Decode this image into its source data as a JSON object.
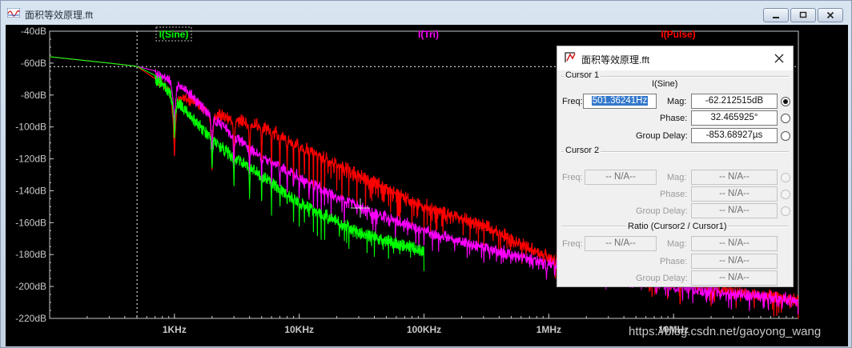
{
  "window": {
    "title": "面积等效原理.fft",
    "controls": [
      "minimize-icon",
      "restore-icon",
      "close-icon"
    ]
  },
  "plot": {
    "traces": [
      {
        "name": "I(Sine)",
        "color": "#00ff00"
      },
      {
        "name": "I(Tri)",
        "color": "#ff00ff"
      },
      {
        "name": "I(Pulse)",
        "color": "#ff0000"
      }
    ],
    "y_ticks": [
      "-40dB",
      "-60dB",
      "-80dB",
      "-100dB",
      "-120dB",
      "-140dB",
      "-160dB",
      "-180dB",
      "-200dB",
      "-220dB"
    ],
    "x_ticks": [
      "1KHz",
      "10KHz",
      "100KHz",
      "1MHz",
      "10MHz"
    ],
    "background": "#000000",
    "axis_color": "#c8c8c8"
  },
  "chart_data": {
    "type": "line",
    "x_scale": "log",
    "xlim": [
      "100Hz",
      "100MHz"
    ],
    "ylim": [
      -220,
      -40
    ],
    "y_unit": "dB",
    "series": [
      {
        "name": "I(Sine)",
        "color": "#00ff00",
        "x": [
          100,
          300,
          500,
          800,
          1500,
          2500,
          5000,
          10000,
          30000,
          100000
        ],
        "y": [
          -56,
          -60,
          -62,
          -70,
          -95,
          -112,
          -128,
          -145,
          -163,
          -175
        ]
      },
      {
        "name": "I(Tri)",
        "color": "#ff00ff",
        "x": [
          100,
          300,
          500,
          1000,
          2000,
          4000,
          10000,
          30000,
          100000,
          200000,
          1000000,
          10000000,
          100000000
        ],
        "y": [
          -56,
          -60,
          -62,
          -68,
          -92,
          -112,
          -130,
          -148,
          -163,
          -170,
          -184,
          -198,
          -207
        ]
      },
      {
        "name": "I(Pulse)",
        "color": "#ff0000",
        "x": [
          100,
          300,
          500,
          1000,
          2000,
          5000,
          10000,
          30000,
          100000,
          300000,
          1000000,
          10000000,
          100000000
        ],
        "y": [
          -56,
          -60,
          -62,
          -78,
          -92,
          -100,
          -112,
          -130,
          -150,
          -162,
          -182,
          -198,
          -208
        ]
      }
    ],
    "cursor1": {
      "x": "501.36241Hz",
      "y": "-62.212515dB"
    }
  },
  "dialog": {
    "title": "面积等效原理.fft",
    "cursor1": {
      "section": "Cursor 1",
      "trace": "I(Sine)",
      "freq_label": "Freq:",
      "freq": "501.36241Hz",
      "mag_label": "Mag:",
      "mag": "-62.212515dB",
      "phase_label": "Phase:",
      "phase": "32.465925°",
      "gd_label": "Group Delay:",
      "gd": "-853.68927µs"
    },
    "cursor2": {
      "section": "Cursor 2",
      "freq_label": "Freq:",
      "freq": "-- N/A--",
      "mag_label": "Mag:",
      "mag": "-- N/A--",
      "phase_label": "Phase:",
      "phase": "-- N/A--",
      "gd_label": "Group Delay:",
      "gd": "-- N/A--"
    },
    "ratio": {
      "section": "Ratio (Cursor2 / Cursor1)",
      "freq_label": "Freq:",
      "freq": "-- N/A--",
      "mag_label": "Mag:",
      "mag": "-- N/A--",
      "phase_label": "Phase:",
      "phase": "-- N/A--",
      "gd_label": "Group Delay:",
      "gd": "-- N/A--"
    }
  },
  "watermark": "https://blog.csdn.net/gaoyong_wang"
}
